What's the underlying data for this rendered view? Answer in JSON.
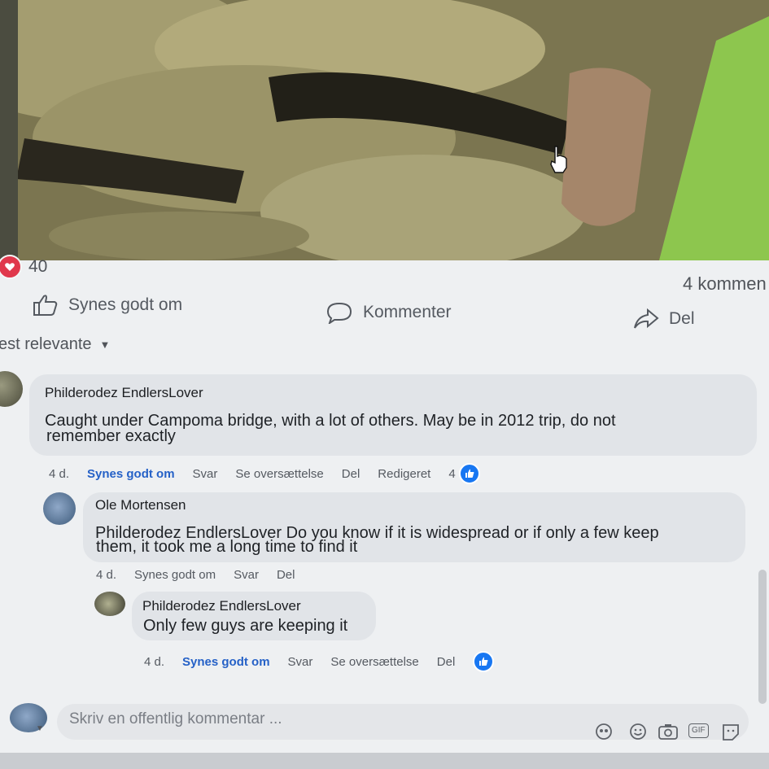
{
  "post": {
    "reaction_count": "40",
    "comments_count": "4 kommen",
    "actions": {
      "like": "Synes godt om",
      "comment": "Kommenter",
      "share": "Del"
    },
    "sort_label": "est relevante"
  },
  "comments": [
    {
      "author": "Philderodez EndlersLover",
      "text_line1": "Caught under Campoma bridge, with a lot of others. May be in 2012 trip, do not",
      "text_line2": "remember exactly",
      "time": "4 d.",
      "like": "Synes godt om",
      "reply": "Svar",
      "translate": "Se oversættelse",
      "share": "Del",
      "edited": "Redigeret",
      "like_count": "4"
    },
    {
      "author": "Ole Mortensen",
      "mention": "Philderodez EndlersLover",
      "text_line1_rest": " Do you know if it is widespread or if only a few keep",
      "text_line2": "them, it took me a long time to find it",
      "time": "4 d.",
      "like": "Synes godt om",
      "reply": "Svar",
      "share": "Del"
    },
    {
      "author": "Philderodez EndlersLover",
      "text": "Only few guys are keeping it",
      "time": "4 d.",
      "like": "Synes godt om",
      "reply": "Svar",
      "translate": "Se oversættelse",
      "share": "Del"
    }
  ],
  "composer": {
    "placeholder": "Skriv en offentlig kommentar ...",
    "gif_label": "GIF"
  },
  "icons": [
    "heart-reaction-icon",
    "thumbs-up-icon",
    "comment-icon",
    "share-icon",
    "caret-down-icon",
    "avatar-icon",
    "smiley-icon",
    "emoji-icon",
    "camera-icon",
    "gif-icon",
    "sticker-icon",
    "cursor-hand-icon"
  ],
  "colors": {
    "accent": "#1877f2",
    "liked_text": "#2561c7",
    "heart": "#e0384c"
  }
}
